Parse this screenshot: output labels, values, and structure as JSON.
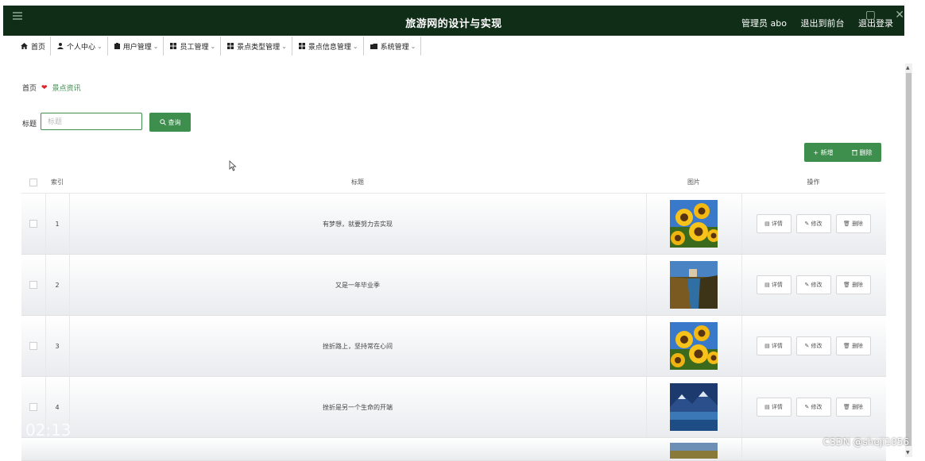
{
  "header": {
    "title": "旅游网的设计与实现",
    "user_label": "管理员 abo",
    "front_link": "退出到前台",
    "logout_link": "退出登录"
  },
  "nav": [
    {
      "label": "首页",
      "icon": "home-icon",
      "has_dropdown": false
    },
    {
      "label": "个人中心",
      "icon": "user-icon",
      "has_dropdown": true
    },
    {
      "label": "用户管理",
      "icon": "clipboard-icon",
      "has_dropdown": true
    },
    {
      "label": "员工管理",
      "icon": "grid-icon",
      "has_dropdown": true
    },
    {
      "label": "景点类型管理",
      "icon": "grid-icon",
      "has_dropdown": true
    },
    {
      "label": "景点信息管理",
      "icon": "grid-icon",
      "has_dropdown": true
    },
    {
      "label": "系统管理",
      "icon": "folder-icon",
      "has_dropdown": true
    }
  ],
  "breadcrumb": {
    "home": "首页",
    "current": "景点资讯"
  },
  "search": {
    "label": "标题",
    "placeholder": "标题",
    "button": "查询"
  },
  "actions": {
    "add": "+ 新增",
    "delete": "删除"
  },
  "table": {
    "columns": [
      "索引",
      "标题",
      "图片",
      "操作"
    ],
    "rows": [
      {
        "index": "1",
        "title": "有梦想，就要努力去实现",
        "image": "sunflower"
      },
      {
        "index": "2",
        "title": "又是一年毕业季",
        "image": "canal"
      },
      {
        "index": "3",
        "title": "挫折路上，坚持常在心间",
        "image": "sunflower"
      },
      {
        "index": "4",
        "title": "挫折是另一个生命的开端",
        "image": "lake"
      }
    ],
    "row_actions": {
      "detail": "详情",
      "edit": "修改",
      "delete": "删除"
    }
  },
  "overlay": {
    "time": "02:13",
    "watermark": "CSDN @sheji1056"
  },
  "colors": {
    "header_bg": "#0f2d17",
    "accent": "#3e8f4d",
    "heart": "#d8262a"
  }
}
